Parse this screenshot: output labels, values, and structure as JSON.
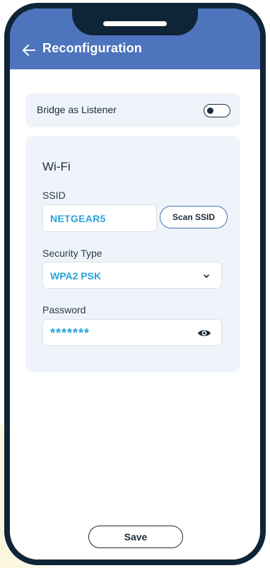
{
  "header": {
    "title": "Reconfiguration",
    "back_icon": "arrow-left-icon"
  },
  "bridge": {
    "label": "Bridge as Listener",
    "toggle_on": false
  },
  "wifi": {
    "title": "Wi-Fi",
    "ssid_label": "SSID",
    "ssid_value": "NETGEAR5",
    "scan_button": "Scan SSID",
    "security_label": "Security Type",
    "security_value": "WPA2 PSK",
    "password_label": "Password",
    "password_value": "*******",
    "password_toggle_icon": "eye-icon"
  },
  "footer": {
    "save_label": "Save"
  },
  "colors": {
    "header": "#4d74bc",
    "phone_frame": "#0f2436",
    "card_bg": "#eef4f9",
    "accent_text": "#29a3d8",
    "dark_text": "#1c2b3a"
  }
}
